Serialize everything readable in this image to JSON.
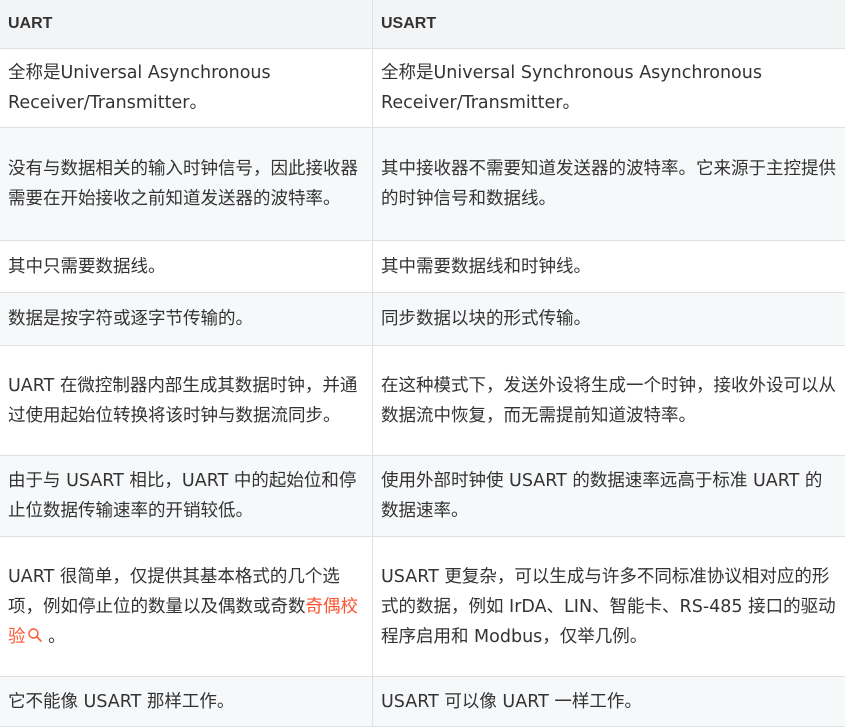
{
  "table": {
    "headers": [
      "UART",
      "USART"
    ],
    "rows": [
      [
        "全称是Universal Asynchronous Receiver/Transmitter。",
        "全称是Universal Synchronous Asynchronous Receiver/Transmitter。"
      ],
      [
        "没有与数据相关的输入时钟信号，因此接收器需要在开始接收之前知道发送器的波特率。",
        "其中接收器不需要知道发送器的波特率。它来源于主控提供的时钟信号和数据线。"
      ],
      [
        "其中只需要数据线。",
        "其中需要数据线和时钟线。"
      ],
      [
        "数据是按字符或逐字节传输的。",
        "同步数据以块的形式传输。"
      ],
      [
        "UART 在微控制器内部生成其数据时钟，并通过使用起始位转换将该时钟与数据流同步。",
        "在这种模式下，发送外设将生成一个时钟，接收外设可以从数据流中恢复，而无需提前知道波特率。"
      ],
      [
        "由于与 USART 相比，UART 中的起始位和停止位数据传输速率的开销较低。",
        "使用外部时钟使 USART 的数据速率远高于标准 UART 的数据速率。"
      ],
      [
        "UART 很简单，仅提供其基本格式的几个选项，例如停止位的数量以及偶数或奇数",
        "USART 更复杂，可以生成与许多不同标准协议相对应的形式的数据，例如 IrDA、LIN、智能卡、RS-485 接口的驱动程序启用和 Modbus，仅举几例。"
      ],
      [
        "它不能像 USART 那样工作。",
        "USART 可以像 UART 一样工作。"
      ]
    ],
    "row7_link": "奇偶校验",
    "row7_suffix": " 。"
  },
  "colors": {
    "link": "#fc5531",
    "header_bg": "#f3f4f6",
    "stripe_bg": "#f6f8fa",
    "border": "#dfe2e5",
    "text": "#333333"
  },
  "icons": {
    "link_icon": "search-icon"
  }
}
